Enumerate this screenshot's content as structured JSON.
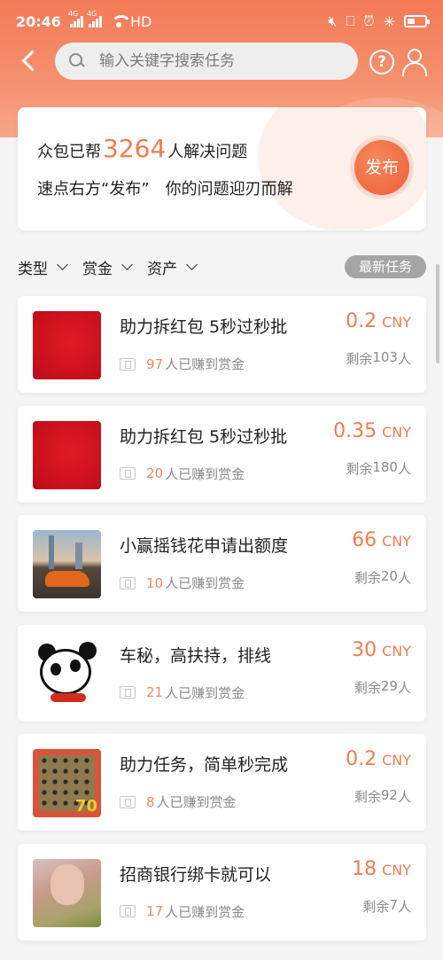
{
  "status_bar": {
    "time": "20:46",
    "signal_tag_1": "4G",
    "signal_tag_2": "4G",
    "network": "HD"
  },
  "search": {
    "placeholder": "输入关键字搜索任务"
  },
  "header": {
    "help_glyph": "?"
  },
  "banner": {
    "line1_prefix": "众包已帮",
    "count": "3264",
    "line1_suffix": "人解决问题",
    "line2": "速点右方“发布”　你的问题迎刃而解",
    "publish_label": "发布"
  },
  "filters": {
    "items": [
      {
        "label": "类型"
      },
      {
        "label": "赏金"
      },
      {
        "label": "资产"
      }
    ],
    "latest_label": "最新任务"
  },
  "task_list": {
    "earned_suffix": "人已赚到赏金",
    "remaining_prefix": "剩余",
    "remaining_suffix": "人",
    "tasks": [
      {
        "title": "助力拆红包 5秒过秒批",
        "earned": "97",
        "amount": "0.2",
        "unit": "CNY",
        "remaining": "103",
        "thumb": "red-envelope-image"
      },
      {
        "title": "助力拆红包 5秒过秒批",
        "earned": "20",
        "amount": "0.35",
        "unit": "CNY",
        "remaining": "180",
        "thumb": "red-envelope-image"
      },
      {
        "title": "小赢摇钱花申请出额度",
        "earned": "10",
        "amount": "66",
        "unit": "CNY",
        "remaining": "20",
        "thumb": "sports-car-city-image"
      },
      {
        "title": "车秘，高扶持，排线",
        "earned": "21",
        "amount": "30",
        "unit": "CNY",
        "remaining": "29",
        "thumb": "panda-mascot-image"
      },
      {
        "title": "助力任务，简单秒完成",
        "earned": "8",
        "amount": "0.2",
        "unit": "CNY",
        "remaining": "92",
        "thumb": "go-board-game-image"
      },
      {
        "title": "招商银行绑卡就可以",
        "earned": "17",
        "amount": "18",
        "unit": "CNY",
        "remaining": "7",
        "thumb": "child-photo-image"
      }
    ]
  },
  "colors": {
    "accent": "#f07d4f",
    "header_gradient_top": "#f47a57",
    "latest_button_bg": "#a5a5a5"
  }
}
